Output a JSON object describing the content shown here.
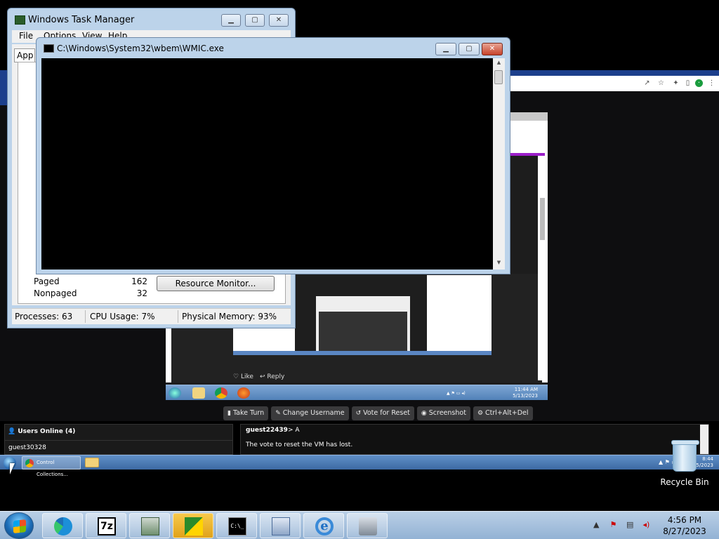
{
  "taskmgr": {
    "title": "Windows Task Manager",
    "menu": [
      "File",
      "Options",
      "View",
      "Help"
    ],
    "first_tab": "App",
    "kernel_rows": [
      {
        "label": "Paged",
        "value": "162"
      },
      {
        "label": "Nonpaged",
        "value": "32"
      }
    ],
    "resource_button": "Resource Monitor...",
    "status": {
      "processes": "Processes: 63",
      "cpu": "CPU Usage: 7%",
      "memory": "Physical Memory: 93%"
    }
  },
  "wmic": {
    "title": "C:\\Windows\\System32\\wbem\\WMIC.exe"
  },
  "vm": {
    "controls": [
      {
        "icon": "mouse-pointer-icon",
        "label": "Take Turn"
      },
      {
        "icon": "user-edit-icon",
        "label": "Change Username"
      },
      {
        "icon": "reset-icon",
        "label": "Vote for Reset"
      },
      {
        "icon": "camera-icon",
        "label": "Screenshot"
      },
      {
        "icon": "gear-icon",
        "label": "Ctrl+Alt+Del"
      }
    ],
    "users_header": "Users Online (4)",
    "users": [
      "guest30328"
    ],
    "chat": [
      {
        "user": "guest22439",
        "text": "> A"
      },
      {
        "user": "",
        "text": "The vote to reset the VM has lost."
      }
    ],
    "inner": {
      "like": "Like",
      "reply": "Reply",
      "time": "11:44 AM",
      "date": "5/13/2023"
    },
    "mid_taskbar": {
      "chrome_label": "Control Collections...",
      "time": "8:44",
      "date": "8/25/2023"
    }
  },
  "desktop": {
    "recycle_bin": "Recycle Bin"
  },
  "taskbar": {
    "apps": [
      "edge",
      "7-zip",
      "network-adapter",
      "security-center",
      "command-prompt",
      "on-screen-keyboard",
      "internet-explorer",
      "control-panel"
    ],
    "time": "4:56 PM",
    "date": "8/27/2023"
  },
  "colors": {
    "title_bar": "#bcd3ea",
    "taskbar": "#a7c2e0",
    "console_bg": "#000000",
    "close_red": "#c7422a"
  }
}
